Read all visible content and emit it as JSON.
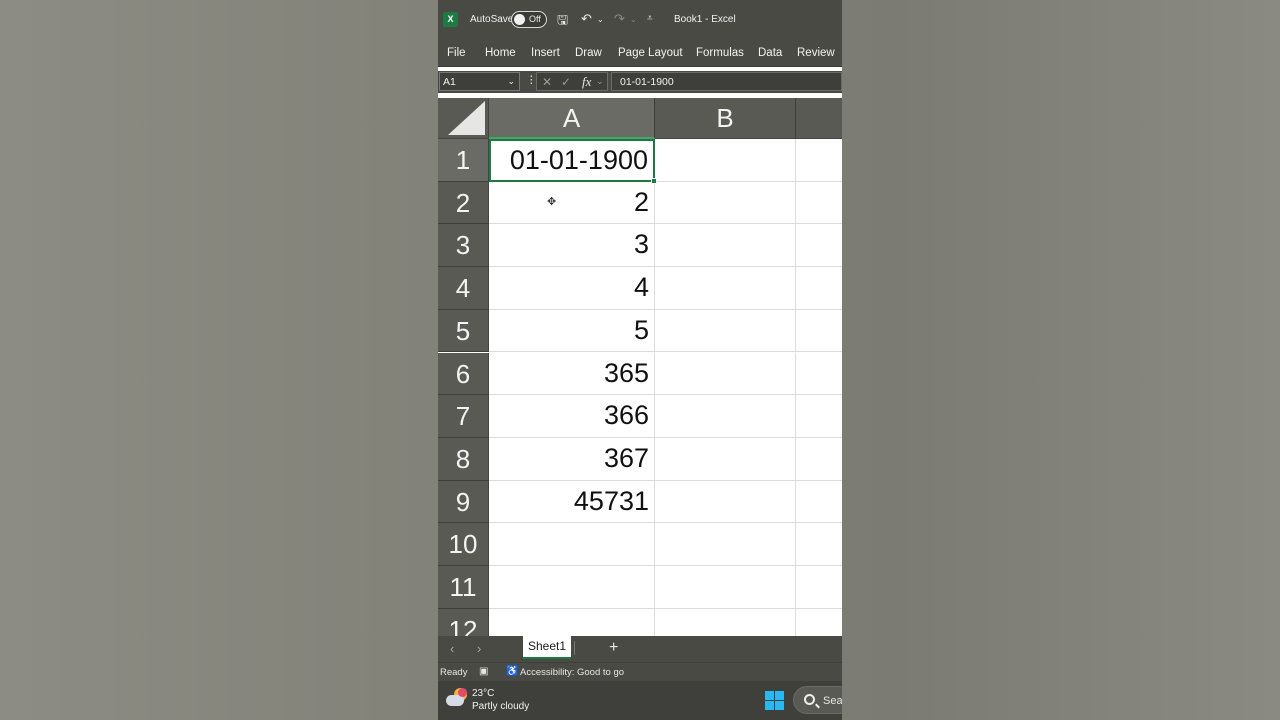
{
  "titlebar": {
    "app_logo": "X",
    "autosave_label": "AutoSave",
    "autosave_state": "Off",
    "doc_title": "Book1  -  Excel"
  },
  "ribbon": {
    "tabs": [
      "File",
      "Home",
      "Insert",
      "Draw",
      "Page Layout",
      "Formulas",
      "Data",
      "Review"
    ]
  },
  "formula_bar": {
    "name_box": "A1",
    "fx_label": "fx",
    "content": "01-01-1900"
  },
  "sheet": {
    "columns": [
      "A",
      "B"
    ],
    "rows": [
      "1",
      "2",
      "3",
      "4",
      "5",
      "6",
      "7",
      "8",
      "9",
      "10",
      "11",
      "12"
    ],
    "cells_A": [
      "01-01-1900",
      "2",
      "3",
      "4",
      "5",
      "365",
      "366",
      "367",
      "45731",
      "",
      "",
      ""
    ],
    "active_cell": "A1"
  },
  "sheet_tabs": {
    "active_tab": "Sheet1",
    "add_label": "+"
  },
  "status": {
    "ready": "Ready",
    "accessibility": "Accessibility: Good to go"
  },
  "taskbar": {
    "temperature": "23°C",
    "condition": "Partly cloudy",
    "search_label": "Sea"
  },
  "colors": {
    "excel_green": "#1e7a45",
    "ribbon_bg": "#4a4a45",
    "header_bg": "#5a5a55"
  }
}
